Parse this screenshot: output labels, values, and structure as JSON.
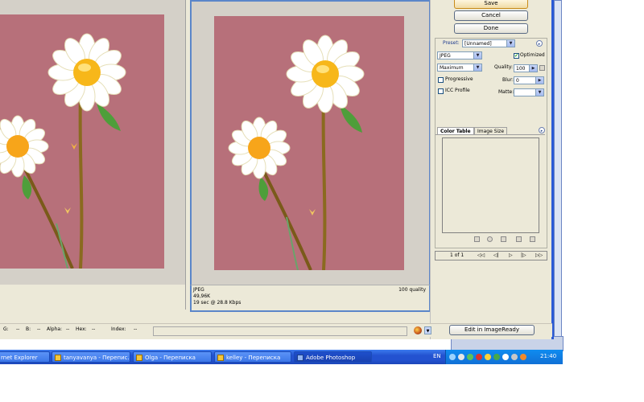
{
  "buttons": {
    "save": "Save",
    "cancel": "Cancel",
    "done": "Done",
    "edit_imageready": "Edit in ImageReady"
  },
  "settings": {
    "preset_label": "Preset:",
    "preset_value": "[Unnamed]",
    "format": "JPEG",
    "quality_level": "Maximum",
    "optimized_label": "Optimized",
    "optimized_checked": true,
    "quality_label": "Quality:",
    "quality_value": "100",
    "progressive_label": "Progressive",
    "progressive_checked": false,
    "blur_label": "Blur:",
    "blur_value": "0",
    "icc_label": "ICC Profile",
    "icc_checked": false,
    "matte_label": "Matte:"
  },
  "tabs": [
    {
      "label": "Color Table",
      "active": true
    },
    {
      "label": "Image Size",
      "active": false
    }
  ],
  "navigation": {
    "page": "1 of 1",
    "first": "◁◁",
    "prev": "◁|",
    "play": "▷",
    "next": "|▷",
    "last": "▷▷"
  },
  "preview_info": {
    "format": "JPEG",
    "size": "49,96K",
    "time": "19 sec @ 28.8 Kbps",
    "quality": "100 quality"
  },
  "status_bar": {
    "g": "G:",
    "g_val": "--",
    "b": "B:",
    "b_val": "--",
    "alpha": "Alpha:",
    "alpha_val": "--",
    "hex": "Hex:",
    "hex_val": "--",
    "index": "Index:",
    "index_val": "--"
  },
  "taskbar": {
    "items": [
      {
        "label": "rnet Explorer",
        "active": false
      },
      {
        "label": "tanyavanya - Перепис...",
        "active": false
      },
      {
        "label": "Olga - Переписка",
        "active": false
      },
      {
        "label": "kelley - Переписка",
        "active": false
      },
      {
        "label": "Adobe Photoshop",
        "active": true
      }
    ],
    "lang": "EN",
    "clock": "21:40"
  },
  "colors": {
    "artwork": "#b7707a",
    "canvas": "#d4d0c8",
    "dialog": "#ece9d8",
    "selection": "#5b86c9",
    "taskbar": "#2352d0"
  },
  "icons": {
    "menu": "circle-arrow-icon",
    "new_color": "add-color-icon",
    "delete": "trash-icon",
    "flower": "daisy-artwork"
  }
}
